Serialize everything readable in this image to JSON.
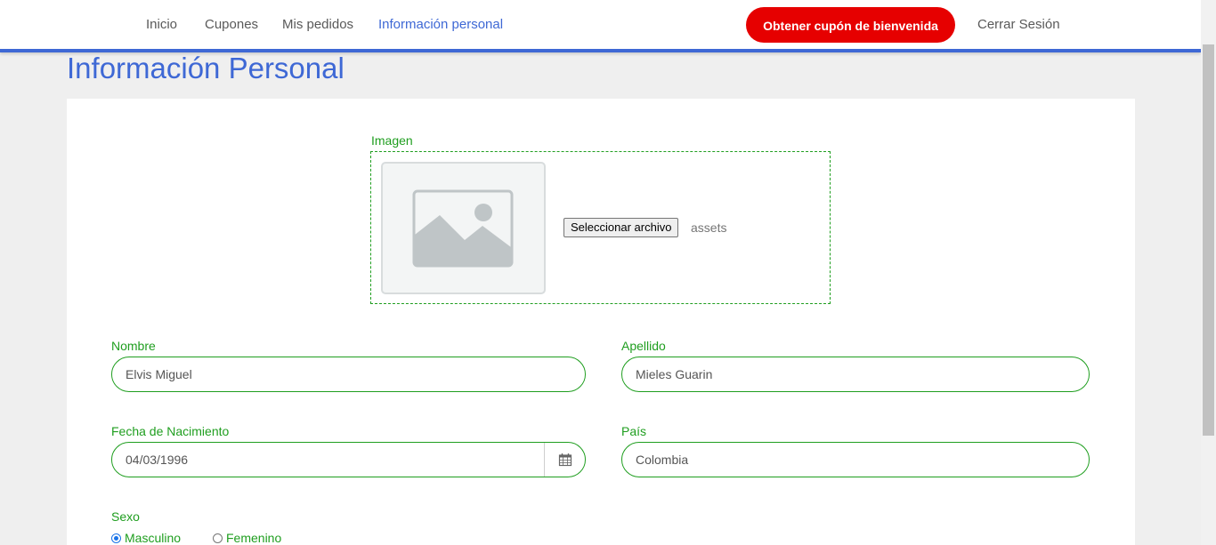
{
  "nav": {
    "links": [
      "Inicio",
      "Cupones",
      "Mis pedidos",
      "Información personal"
    ],
    "active_index": 3,
    "cta_label": "Obtener cupón de bienvenida",
    "logout_label": "Cerrar Sesión"
  },
  "page": {
    "title": "Información Personal"
  },
  "form": {
    "image": {
      "label": "Imagen",
      "button_label": "Seleccionar archivo",
      "file_name": "assets",
      "placeholder_icon": "image-placeholder-icon"
    },
    "nombre": {
      "label": "Nombre",
      "value": "Elvis Miguel"
    },
    "apellido": {
      "label": "Apellido",
      "value": "Mieles Guarin"
    },
    "fecha": {
      "label": "Fecha de Nacimiento",
      "value": "04/03/1996",
      "icon": "calendar-icon"
    },
    "pais": {
      "label": "País",
      "value": "Colombia"
    },
    "sexo": {
      "label": "Sexo",
      "options": [
        "Masculino",
        "Femenino"
      ],
      "selected": "Masculino"
    }
  },
  "colors": {
    "accent": "#3e68d5",
    "cta": "#e60000",
    "form_green": "#1f9e1f"
  }
}
